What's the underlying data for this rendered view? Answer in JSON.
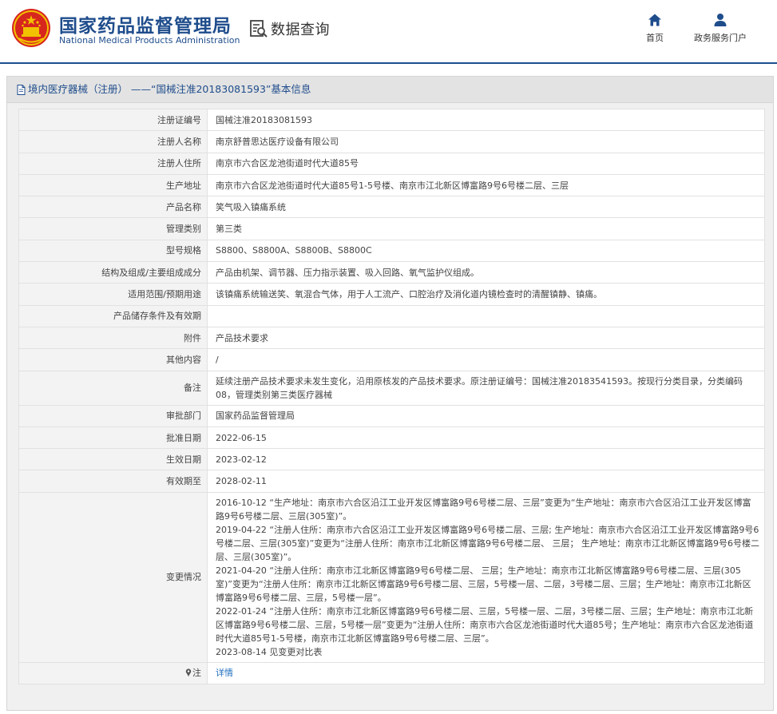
{
  "header": {
    "brand_cn": "国家药品监督管理局",
    "brand_en": "National Medical Products Administration",
    "module_title": "数据查询",
    "nav": [
      {
        "label": "首页",
        "icon": "home-icon"
      },
      {
        "label": "政务服务门户",
        "icon": "user-icon"
      }
    ],
    "colors": {
      "brand": "#1f4d8c",
      "emblem_red": "#d7261e",
      "emblem_gold": "#f2c200"
    }
  },
  "panel": {
    "title": "境内医疗器械（注册） ——“国械注准20183081593”基本信息",
    "title_icon": "document-icon"
  },
  "rows": [
    {
      "label": "注册证编号",
      "value": "国械注准20183081593"
    },
    {
      "label": "注册人名称",
      "value": "南京舒普思达医疗设备有限公司"
    },
    {
      "label": "注册人住所",
      "value": "南京市六合区龙池街道时代大道85号"
    },
    {
      "label": "生产地址",
      "value": "南京市六合区龙池街道时代大道85号1-5号楼、南京市江北新区博富路9号6号楼二层、三层"
    },
    {
      "label": "产品名称",
      "value": "笑气吸入镇痛系统"
    },
    {
      "label": "管理类别",
      "value": "第三类"
    },
    {
      "label": "型号规格",
      "value": "S8800、S8800A、S8800B、S8800C"
    },
    {
      "label": "结构及组成/主要组成成分",
      "value": "产品由机架、调节器、压力指示装置、吸入回路、氧气监护仪组成。"
    },
    {
      "label": "适用范围/预期用途",
      "value": "该镇痛系统输送笑、氧混合气体，用于人工流产、口腔治疗及消化道内镜检查时的清醒镇静、镇痛。"
    },
    {
      "label": "产品储存条件及有效期",
      "value": ""
    },
    {
      "label": "附件",
      "value": "产品技术要求"
    },
    {
      "label": "其他内容",
      "value": "/"
    },
    {
      "label": "备注",
      "value": "延续注册产品技术要求未发生变化，沿用原核发的产品技术要求。原注册证编号：国械注准20183541593。按现行分类目录，分类编码08，管理类别第三类医疗器械"
    },
    {
      "label": "审批部门",
      "value": "国家药品监督管理局"
    },
    {
      "label": "批准日期",
      "value": "2022-06-15"
    },
    {
      "label": "生效日期",
      "value": "2023-02-12"
    },
    {
      "label": "有效期至",
      "value": "2028-02-11"
    }
  ],
  "changes": {
    "label": "变更情况",
    "entries": [
      "2016-10-12 “生产地址：南京市六合区沿江工业开发区博富路9号6号楼二层、三层”变更为“生产地址：南京市六合区沿江工业开发区博富路9号6号楼二层、三层(305室)”。",
      "2019-04-22 “注册人住所：南京市六合区沿江工业开发区博富路9号6号楼二层、三层; 生产地址：南京市六合区沿江工业开发区博富路9号6号楼二层、三层(305室)”变更为“注册人住所：南京市江北新区博富路9号6号楼二层、 三层； 生产地址：南京市江北新区博富路9号6号楼二层、三层(305室)”。",
      "2021-04-20 “注册人住所：南京市江北新区博富路9号6号楼二层、 三层；生产地址：南京市江北新区博富路9号6号楼二层、三层(305室)”变更为“注册人住所：南京市江北新区博富路9号6号楼二层、三层，5号楼一层、二层，3号楼二层、三层；生产地址：南京市江北新区博富路9号6号楼二层、三层，5号楼一层”。",
      "2022-01-24 “注册人住所：南京市江北新区博富路9号6号楼二层、三层，5号楼一层、二层，3号楼二层、三层；生产地址：南京市江北新区博富路9号6号楼二层、三层，5号楼一层”变更为“注册人住所：南京市六合区龙池街道时代大道85号；生产地址：南京市六合区龙池街道时代大道85号1-5号楼，南京市江北新区博富路9号6号楼二层、三层”。",
      "2023-08-14 见变更对比表"
    ]
  },
  "note": {
    "label": "注",
    "link_text": "详情",
    "icon": "pin-icon"
  }
}
